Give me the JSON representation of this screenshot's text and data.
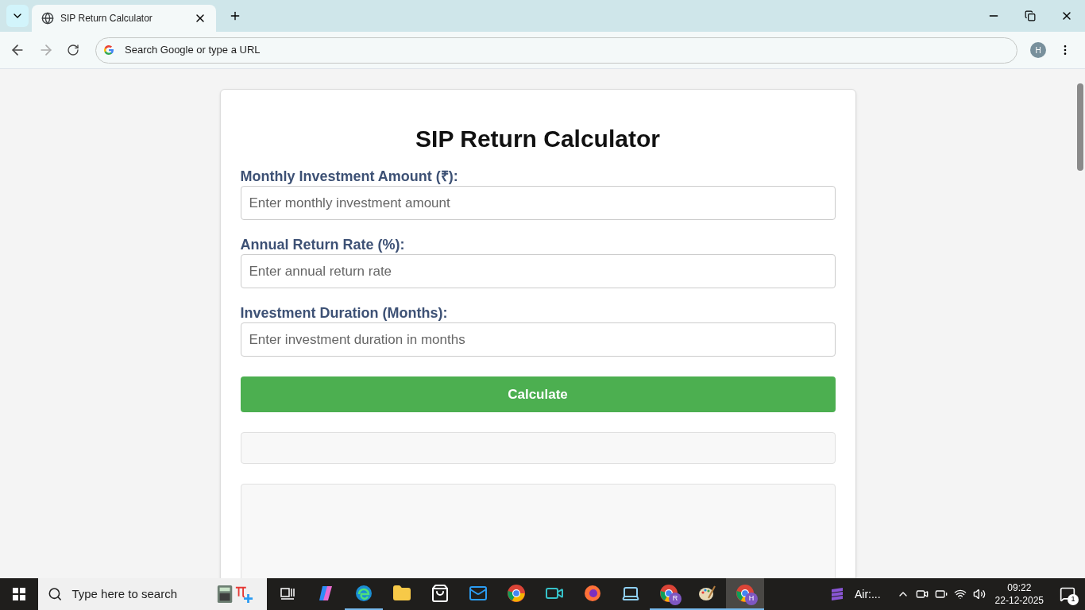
{
  "browser": {
    "tabs": [
      {
        "title": "SIP Return Calculator",
        "selected": true
      }
    ],
    "address_bar": {
      "placeholder": "Search Google or type a URL"
    },
    "profile": {
      "initial": "H"
    }
  },
  "page": {
    "title": "SIP Return Calculator",
    "fields": [
      {
        "label": "Monthly Investment Amount (₹):",
        "placeholder": "Enter monthly investment amount"
      },
      {
        "label": "Annual Return Rate (%):",
        "placeholder": "Enter annual return rate"
      },
      {
        "label": "Investment Duration (Months):",
        "placeholder": "Enter investment duration in months"
      }
    ],
    "button": "Calculate"
  },
  "taskbar": {
    "search": {
      "placeholder": "Type here to search"
    },
    "apps": [
      {
        "kind": "taskview",
        "running": false,
        "selected": false
      },
      {
        "kind": "copilot",
        "running": false,
        "selected": false
      },
      {
        "kind": "edge",
        "running": true,
        "selected": false
      },
      {
        "kind": "folder",
        "running": false,
        "selected": false
      },
      {
        "kind": "store",
        "running": false,
        "selected": false
      },
      {
        "kind": "mail",
        "running": false,
        "selected": false
      },
      {
        "kind": "chrome",
        "running": false,
        "selected": false
      },
      {
        "kind": "recorder",
        "running": false,
        "selected": false
      },
      {
        "kind": "firefox",
        "running": false,
        "selected": false
      },
      {
        "kind": "laptop",
        "running": false,
        "selected": false
      },
      {
        "kind": "chrome",
        "badge": "R",
        "running": true,
        "selected": false
      },
      {
        "kind": "paint",
        "running": true,
        "selected": false
      },
      {
        "kind": "chrome",
        "badge": "H",
        "running": true,
        "selected": true
      }
    ],
    "weather": "Air:...",
    "time": "09:22",
    "date": "22-12-2025",
    "notifications": "1"
  }
}
